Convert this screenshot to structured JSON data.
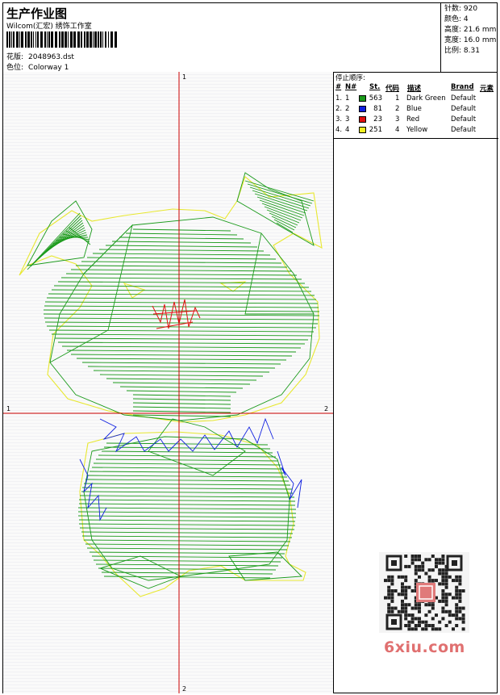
{
  "header": {
    "title": "生产作业图",
    "company": "Wilcom(汇宏) 绣饰工作室",
    "design_label": "花版:",
    "design_value": "2048963.dst",
    "colorway_label": "色位:",
    "colorway_value": "Colorway 1"
  },
  "stats": [
    {
      "label": "针数:",
      "value": "920"
    },
    {
      "label": "颜色:",
      "value": "4"
    },
    {
      "label": "高度:",
      "value": "21.6 mm"
    },
    {
      "label": "宽度:",
      "value": "16.0 mm"
    },
    {
      "label": "比例:",
      "value": "8.31"
    }
  ],
  "axes": {
    "top": "1",
    "bottom": "2",
    "left": "1",
    "right": "2"
  },
  "stop_sequence": {
    "caption": "停止顺序:",
    "headers": {
      "num": "#",
      "no": "N#",
      "st": "St.",
      "code": "代码",
      "desc": "描述",
      "brand": "Brand",
      "elem": "元素"
    },
    "rows": [
      {
        "num": "1.",
        "no": "1",
        "color": "#1a9a1a",
        "st": "563",
        "code": "1",
        "desc": "Dark Green",
        "brand": "Default"
      },
      {
        "num": "2.",
        "no": "2",
        "color": "#1020e0",
        "st": "81",
        "code": "2",
        "desc": "Blue",
        "brand": "Default"
      },
      {
        "num": "3.",
        "no": "3",
        "color": "#e01010",
        "st": "23",
        "code": "3",
        "desc": "Red",
        "brand": "Default"
      },
      {
        "num": "4.",
        "no": "4",
        "color": "#f0f020",
        "st": "251",
        "code": "4",
        "desc": "Yellow",
        "brand": "Default"
      }
    ]
  },
  "watermark": "6xiu.com"
}
